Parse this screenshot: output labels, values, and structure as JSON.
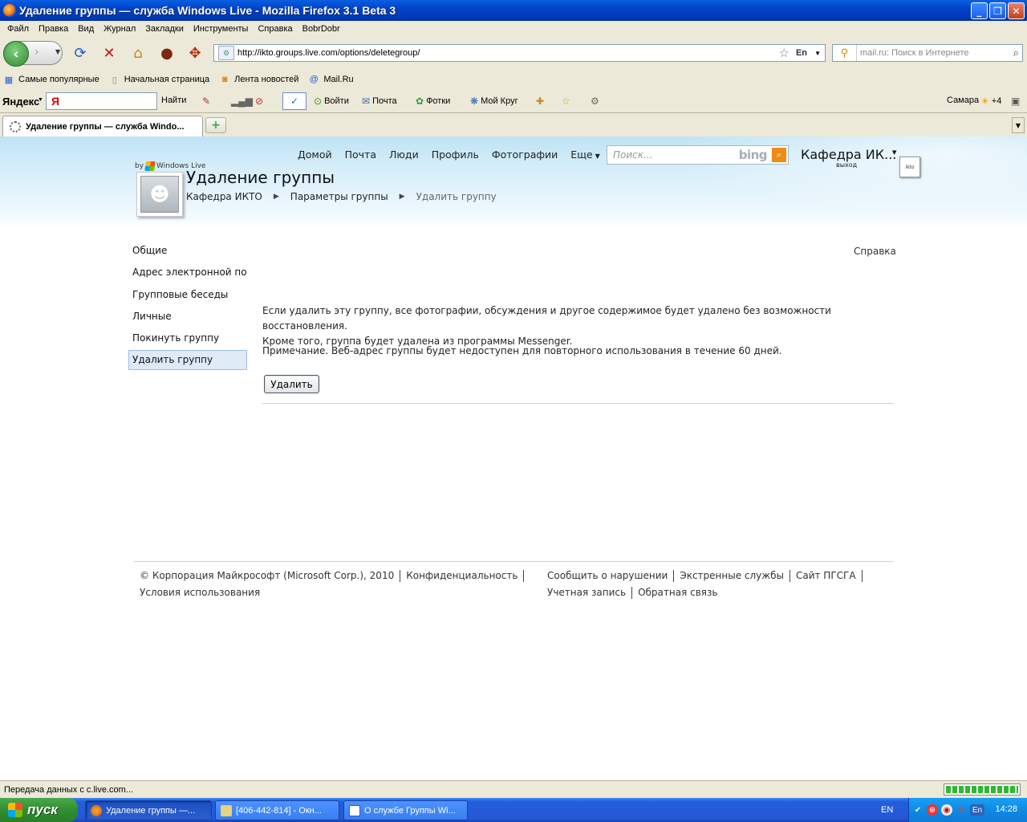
{
  "window": {
    "title": "Удаление группы — служба Windows Live - Mozilla Firefox 3.1 Beta 3",
    "min_label": "_",
    "max_label": "❐",
    "close_label": "✕"
  },
  "menu": [
    "Файл",
    "Правка",
    "Вид",
    "Журнал",
    "Закладки",
    "Инструменты",
    "Справка",
    "BobrDobr"
  ],
  "nav": {
    "url": "http://ikto.groups.live.com/options/deletegroup/",
    "lang_badge": "En",
    "search_placeholder": "mail.ru: Поиск в Интернете"
  },
  "bookmarks": [
    {
      "label": "Самые популярные",
      "icon": "bookmark-folder-icon"
    },
    {
      "label": "Начальная страница",
      "icon": "page-icon"
    },
    {
      "label": "Лента новостей",
      "icon": "rss-icon"
    },
    {
      "label": "Mail.Ru",
      "icon": "at-icon"
    }
  ],
  "yandex": {
    "logo": "Яндекс",
    "input_value": "Я",
    "find": "Найти",
    "login": "Войти",
    "mail": "Почта",
    "photos": "Фотки",
    "circle": "Мой Круг",
    "city": "Самара",
    "temp": "+4"
  },
  "tab": {
    "title": "Удаление группы — служба Windo...",
    "newtab": "+"
  },
  "site": {
    "topnav": [
      "Домой",
      "Почта",
      "Люди",
      "Профиль",
      "Фотографии",
      "Еще"
    ],
    "search_placeholder": "Поиск...",
    "bing": "bing",
    "user_name": "Кафедра ИК...",
    "signout": "выход",
    "by": "by",
    "windows_live": "Windows Live",
    "page_title": "Удаление группы",
    "breadcrumb": [
      "Кафедра ИКТО",
      "Параметры группы",
      "Удалить группу"
    ],
    "leftnav": [
      "Общие",
      "Адрес электронной почт",
      "Групповые беседы",
      "Личные",
      "Покинуть группу",
      "Удалить группу"
    ],
    "help": "Справка",
    "main_line1": "Если удалить эту группу, все фотографии, обсуждения и другое содержимое будет удалено без возможности восстановления.",
    "main_line2": "Кроме того, группа будет удалена из программы Messenger.",
    "note": "Примечание. Веб-адрес группы будет недоступен для повторного использования в течение 60 дней.",
    "delete_button": "Удалить",
    "footer_left": [
      "© Корпорация Майкрософт (Microsoft Corp.), 2010",
      "Конфиденциальность",
      "Условия использования"
    ],
    "footer_right": [
      "Сообщить о нарушении",
      "Экстренные службы",
      "Сайт ПГСГА",
      "Учетная запись",
      "Обратная связь"
    ]
  },
  "status": {
    "text": "Передача данных с c.live.com...",
    "progress": 1.0
  },
  "taskbar": {
    "start": "пуск",
    "tasks": [
      "Удаление группы —...",
      "[406-442-814] - Окн...",
      "О службе Группы Wi..."
    ],
    "lang": "EN",
    "tray_lang": "En",
    "clock": "14:28"
  }
}
